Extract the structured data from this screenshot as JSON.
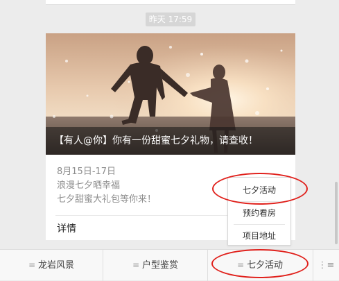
{
  "chat": {
    "timestamp": "昨天 17:59"
  },
  "article_card": {
    "caption": "【有人@你】你有一份甜蜜七夕礼物，请查收！",
    "desc_lines": [
      "8月15日-17日",
      "浪漫七夕晒幸福",
      "七夕甜蜜大礼包等你来！"
    ],
    "details_label": "详情"
  },
  "bottom_menu": {
    "items": [
      {
        "label": "龙岩风景"
      },
      {
        "label": "户型鉴赏"
      },
      {
        "label": "七夕活动"
      }
    ],
    "menu_glyph": "≡",
    "keyboard_glyph": "⋮≡",
    "keyboard_icon": "keyboard-switch-icon"
  },
  "submenu": {
    "items": [
      {
        "label": "七夕活动"
      },
      {
        "label": "预约看房"
      },
      {
        "label": "项目地址"
      }
    ]
  },
  "colors": {
    "annotation_red": "#e0201b",
    "background": "#ececec",
    "timestamp_bg": "#d6d6d6"
  }
}
